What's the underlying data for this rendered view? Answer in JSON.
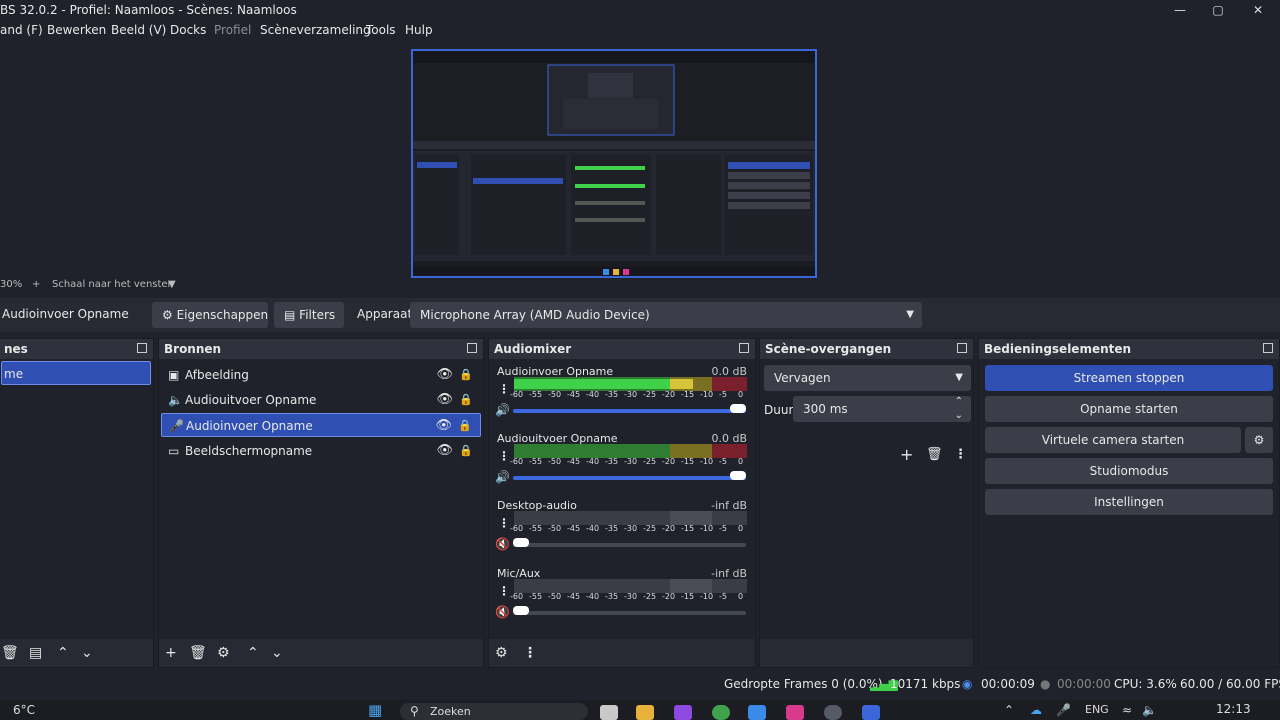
{
  "window": {
    "title": "BS 32.0.2 - Profiel: Naamloos - Scènes: Naamloos"
  },
  "menu": [
    {
      "label": "and (F)",
      "disabled": false
    },
    {
      "label": "Bewerken",
      "disabled": false
    },
    {
      "label": "Beeld (V)",
      "disabled": false
    },
    {
      "label": "Docks",
      "disabled": false
    },
    {
      "label": "Profiel",
      "disabled": true
    },
    {
      "label": "Scèneverzameling",
      "disabled": false
    },
    {
      "label": "Tools",
      "disabled": false
    },
    {
      "label": "Hulp",
      "disabled": false
    }
  ],
  "zoom": {
    "value": "30%",
    "plus": "+",
    "mode": "Schaal naar het venster"
  },
  "source_toolbar": {
    "source_name": "Audioinvoer Opname",
    "properties": "Eigenschappen",
    "filters": "Filters",
    "device_label": "Apparaat",
    "device_value": "Microphone Array (AMD Audio Device)"
  },
  "scenes": {
    "title": "nes",
    "items": [
      "me"
    ]
  },
  "sources": {
    "title": "Bronnen",
    "items": [
      {
        "label": "Afbeelding",
        "icon": "image-icon",
        "selected": false
      },
      {
        "label": "Audiouitvoer Opname",
        "icon": "speaker-icon",
        "selected": false
      },
      {
        "label": "Audioinvoer Opname",
        "icon": "microphone-icon",
        "selected": true
      },
      {
        "label": "Beeldschermopname",
        "icon": "monitor-icon",
        "selected": false
      }
    ]
  },
  "mixer": {
    "title": "Audiomixer",
    "ticks": [
      "-60",
      "-55",
      "-50",
      "-45",
      "-40",
      "-35",
      "-30",
      "-25",
      "-20",
      "-15",
      "-10",
      "-5",
      "0"
    ],
    "channels": [
      {
        "name": "Audioinvoer Opname",
        "db": "0.0 dB",
        "level": 0.77,
        "volume": 1.0,
        "muted": false
      },
      {
        "name": "Audiouitvoer Opname",
        "db": "0.0 dB",
        "level": 0.0,
        "volume": 1.0,
        "muted": false
      },
      {
        "name": "Desktop-audio",
        "db": "-inf dB",
        "level": 0.0,
        "volume": 0.0,
        "muted": true
      },
      {
        "name": "Mic/Aux",
        "db": "-inf dB",
        "level": 0.0,
        "volume": 0.0,
        "muted": true
      }
    ]
  },
  "transitions": {
    "title": "Scène-overgangen",
    "type": "Vervagen",
    "duration_label": "Duur",
    "duration_value": "300 ms"
  },
  "controls": {
    "title": "Bedieningselementen",
    "buttons": [
      "Streamen stoppen",
      "Opname starten",
      "Virtuele camera starten",
      "Studiomodus",
      "Instellingen"
    ]
  },
  "status": {
    "dropped": "Gedropte Frames 0 (0.0%)",
    "bitrate": "10171 kbps",
    "stream_time": "00:00:09",
    "rec_time": "00:00:00",
    "cpu": "CPU: 3.6%",
    "fps": "60.00 / 60.00 FPS"
  },
  "taskbar": {
    "weather": "6°C",
    "search": "Zoeken",
    "lang": "ENG",
    "clock": "12:13"
  },
  "colors": {
    "accent": "#2f4fb3",
    "meter_green": "#3fd14a",
    "meter_yellow": "#d6c53a",
    "meter_red": "#c8283a"
  }
}
